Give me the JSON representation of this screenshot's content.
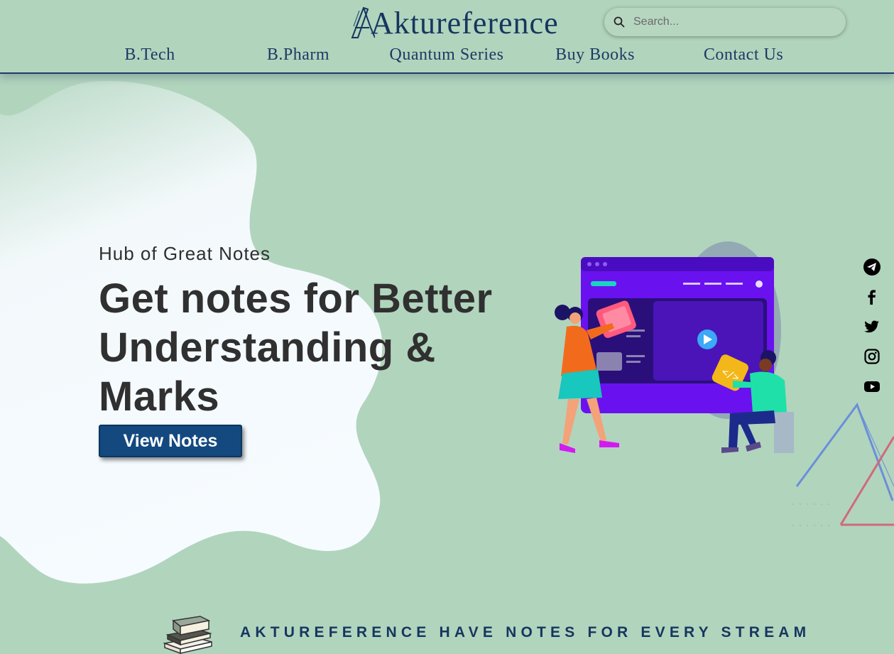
{
  "header": {
    "logo_text": "Aktureference",
    "search": {
      "placeholder": "Search..."
    },
    "nav": [
      {
        "label": "B.Tech"
      },
      {
        "label": "B.Pharm"
      },
      {
        "label": "Quantum Series"
      },
      {
        "label": "Buy Books"
      },
      {
        "label": "Contact Us"
      }
    ]
  },
  "hero": {
    "subtitle": "Hub of Great Notes",
    "title": "Get notes for Better Understanding & Marks",
    "button_label": "View Notes"
  },
  "social": [
    "telegram-icon",
    "facebook-icon",
    "twitter-icon",
    "instagram-icon",
    "youtube-icon"
  ],
  "footer": {
    "tagline": "AKTUREFERENCE HAVE NOTES FOR EVERY STREAM"
  },
  "colors": {
    "background": "#b1d4bd",
    "nav_text": "#1c3b66",
    "button": "#13497f",
    "blob": "#f5faff"
  }
}
